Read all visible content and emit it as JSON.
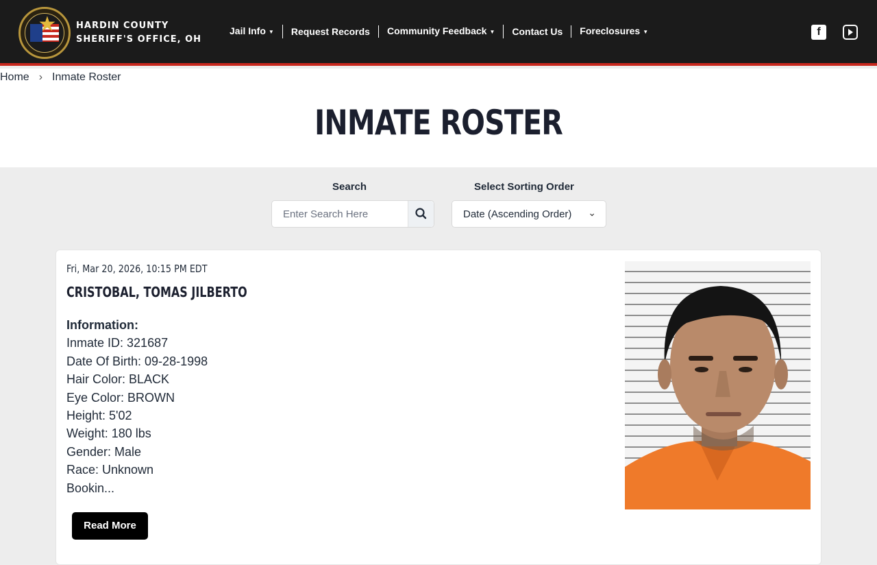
{
  "header": {
    "brand_line1": "HARDIN COUNTY",
    "brand_line2": "SHERIFF'S OFFICE, OH",
    "nav": [
      {
        "label": "Jail Info",
        "dropdown": true
      },
      {
        "label": "Request Records",
        "dropdown": false
      },
      {
        "label": "Community Feedback",
        "dropdown": true
      },
      {
        "label": "Contact Us",
        "dropdown": false
      },
      {
        "label": "Foreclosures",
        "dropdown": true
      }
    ],
    "social": [
      "facebook-icon",
      "youtube-icon"
    ]
  },
  "breadcrumb": {
    "home": "Home",
    "separator": "›",
    "current": "Inmate Roster"
  },
  "page_title": "INMATE ROSTER",
  "search": {
    "label": "Search",
    "placeholder": "Enter Search Here"
  },
  "sort": {
    "label": "Select Sorting Order",
    "selected": "Date (Ascending Order)"
  },
  "inmate": {
    "date": "Fri, Mar 20, 2026, 10:15 PM EDT",
    "name": "CRISTOBAL, TOMAS JILBERTO",
    "info_heading": "Information:",
    "inmate_id": "Inmate ID: 321687",
    "dob": "Date Of Birth: 09-28-1998",
    "hair": "Hair Color: BLACK",
    "eyes": "Eye Color: BROWN",
    "height": "Height: 5'02",
    "weight": "Weight: 180 lbs",
    "gender": "Gender: Male",
    "race": "Race: Unknown",
    "booking": "Bookin...",
    "read_more": "Read More"
  },
  "colors": {
    "header_bg": "#1b1b1b",
    "header_accent": "#c8281e",
    "page_bg": "#ededed",
    "button_bg": "#000000"
  }
}
